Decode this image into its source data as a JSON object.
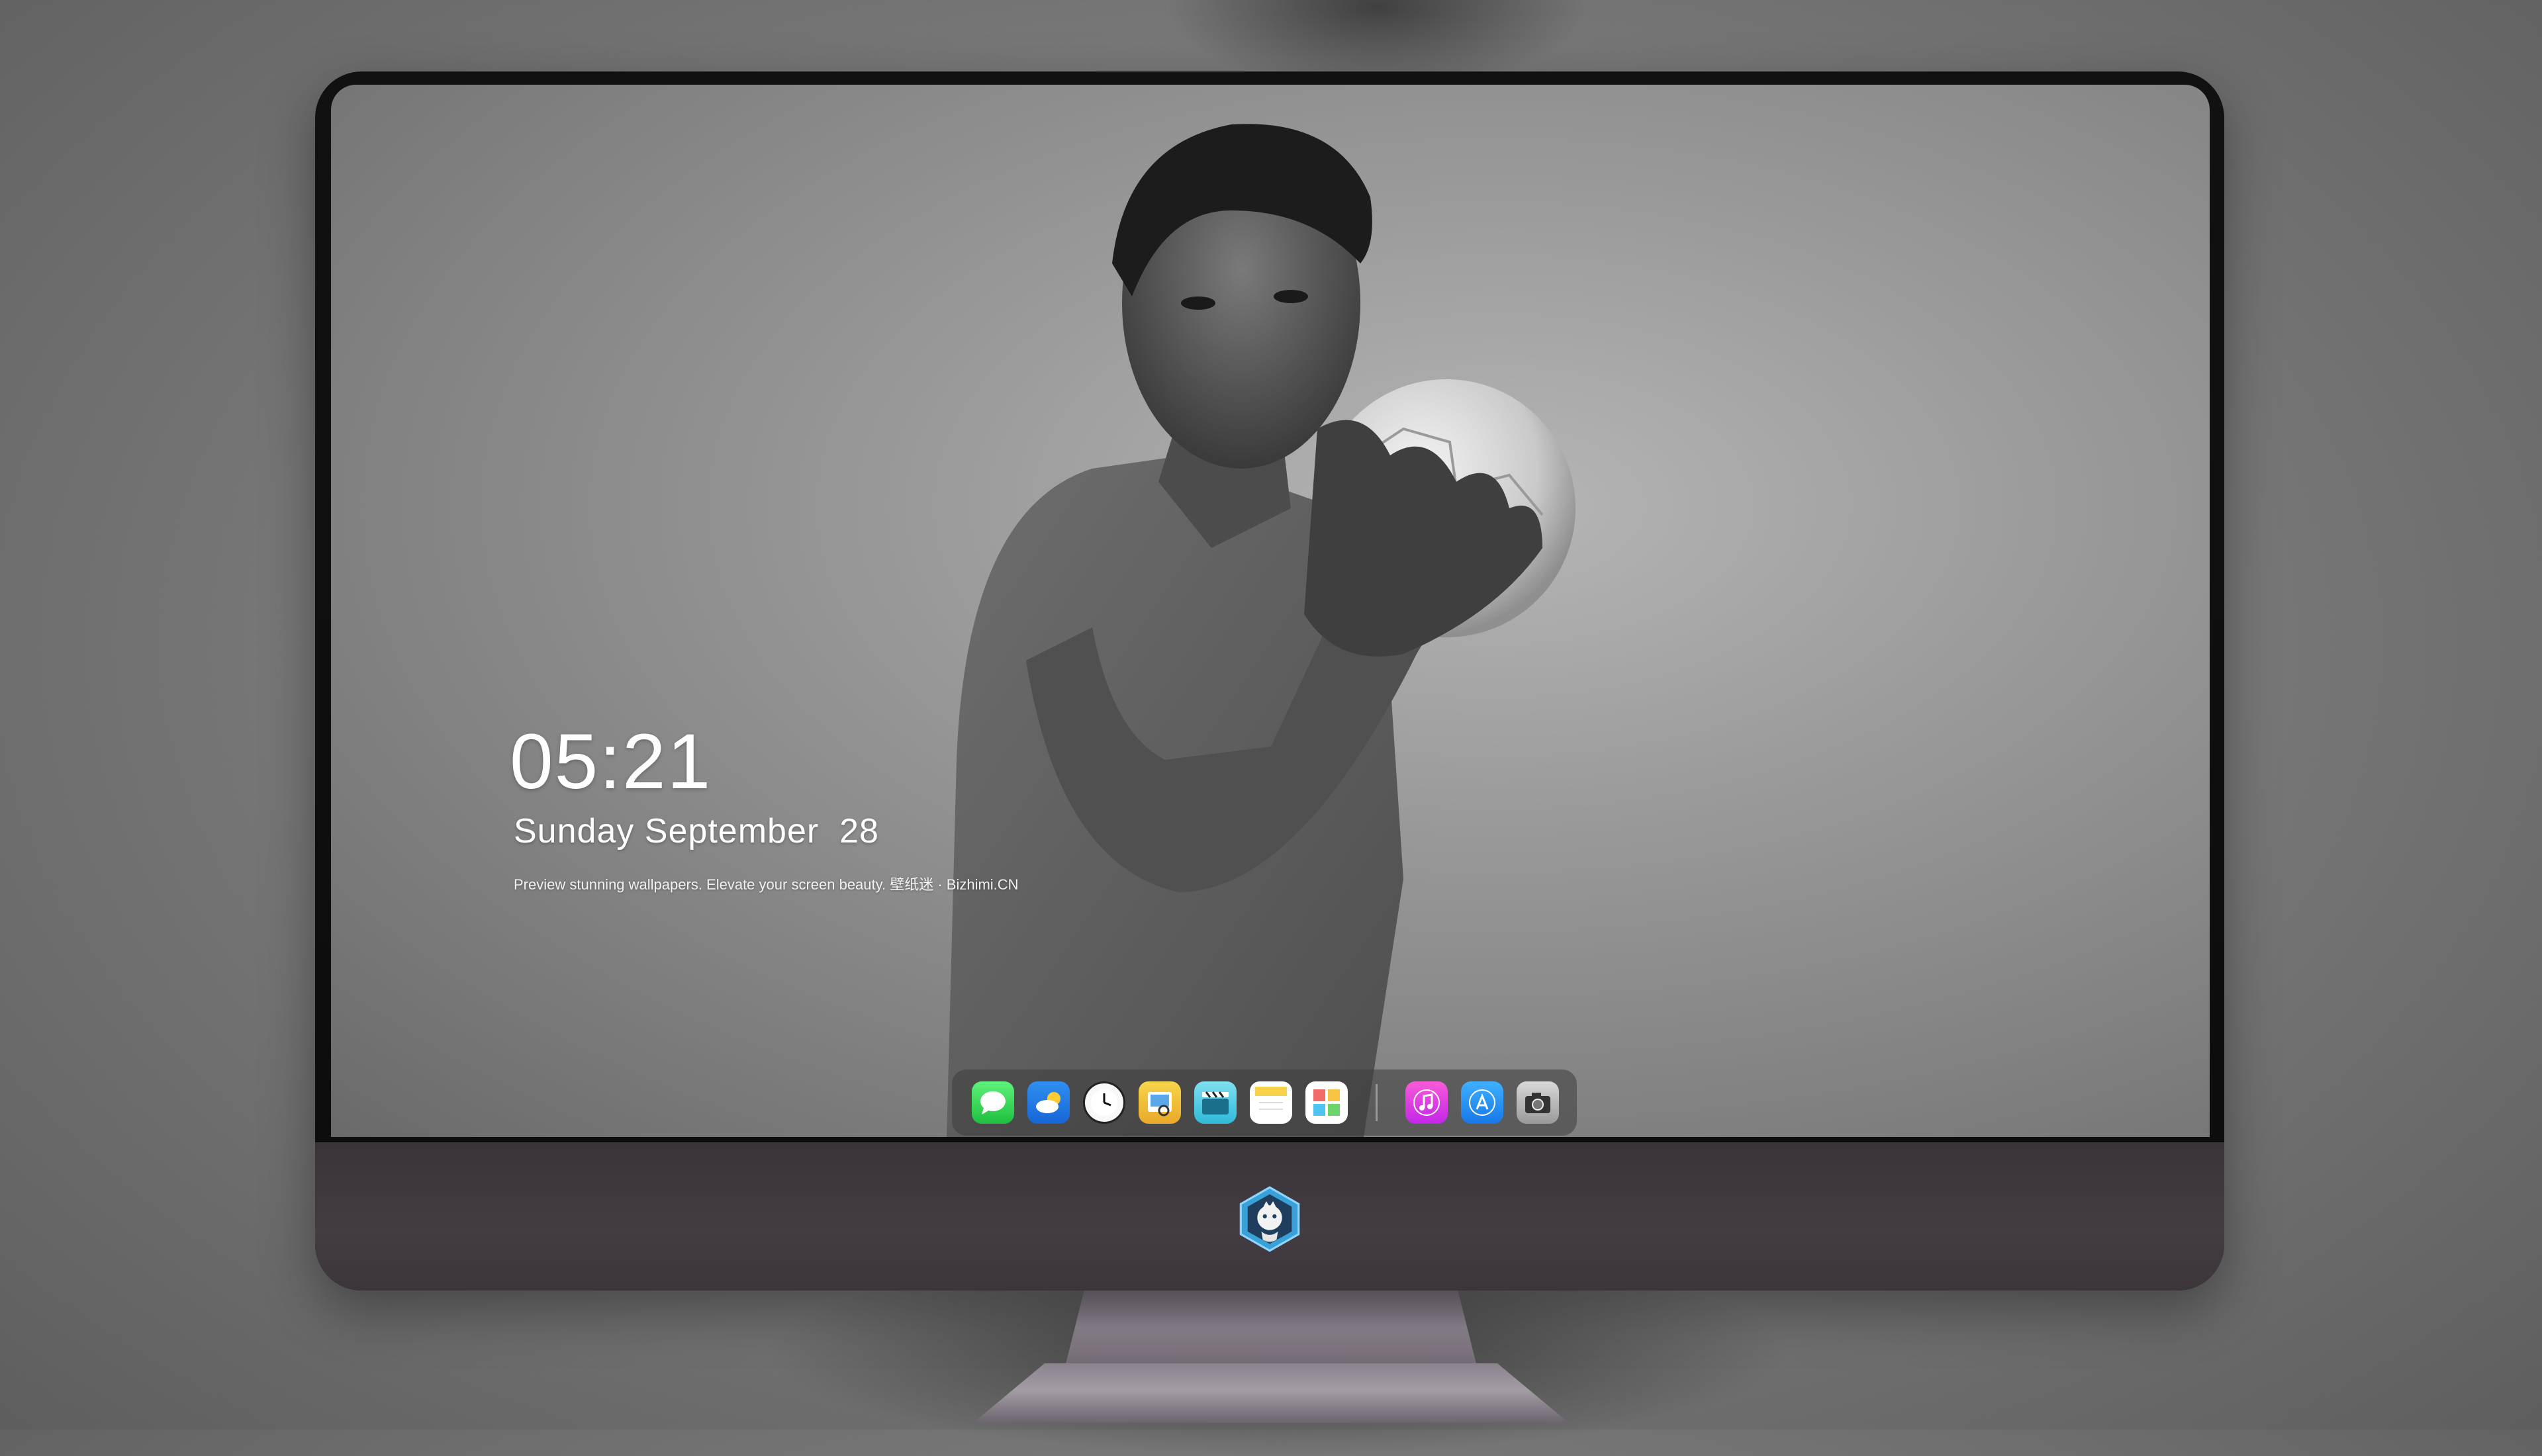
{
  "lock_screen": {
    "time": "05:21",
    "date": "Sunday September  28",
    "tagline": "Preview stunning wallpapers. Elevate your screen beauty. 壁纸迷 · Bizhimi.CN"
  },
  "dock": {
    "apps": [
      {
        "name": "Messages",
        "icon": "messages-icon"
      },
      {
        "name": "Weather",
        "icon": "weather-icon"
      },
      {
        "name": "Clock",
        "icon": "clock-icon"
      },
      {
        "name": "Preview",
        "icon": "preview-icon"
      },
      {
        "name": "Video",
        "icon": "clapperboard-icon"
      },
      {
        "name": "Notes",
        "icon": "notes-icon"
      },
      {
        "name": "Photo Viewer",
        "icon": "photo-viewer-icon"
      },
      {
        "name": "Music",
        "icon": "music-icon"
      },
      {
        "name": "App Store",
        "icon": "app-store-icon"
      },
      {
        "name": "Camera",
        "icon": "camera-icon"
      }
    ]
  },
  "colors": {
    "monitor_chin": "#433c42",
    "bezel": "#0c0c0c",
    "dock_bg": "#3c3c3c",
    "text": "#ffffff"
  }
}
